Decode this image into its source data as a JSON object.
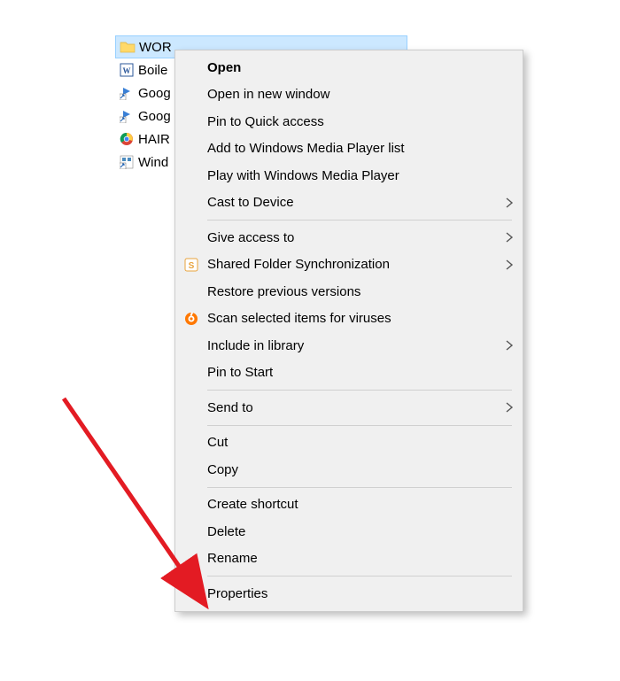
{
  "explorer": {
    "items": [
      {
        "label": "WOR",
        "icon": "folder-icon",
        "selected": true
      },
      {
        "label": "Boile",
        "icon": "word-doc-icon",
        "selected": false
      },
      {
        "label": "Goog",
        "icon": "shortcut-icon",
        "selected": false
      },
      {
        "label": "Goog",
        "icon": "shortcut-icon",
        "selected": false
      },
      {
        "label": "HAIR",
        "icon": "chrome-icon",
        "selected": false
      },
      {
        "label": "Wind",
        "icon": "app-shortcut-icon",
        "selected": false
      }
    ]
  },
  "context_menu": {
    "items": [
      {
        "label": "Open",
        "bold": true
      },
      {
        "label": "Open in new window"
      },
      {
        "label": "Pin to Quick access"
      },
      {
        "label": "Add to Windows Media Player list"
      },
      {
        "label": "Play with Windows Media Player"
      },
      {
        "label": "Cast to Device",
        "submenu": true
      },
      {
        "separator": true
      },
      {
        "label": "Give access to",
        "submenu": true
      },
      {
        "label": "Shared Folder Synchronization",
        "icon": "sync-icon",
        "submenu": true
      },
      {
        "label": "Restore previous versions"
      },
      {
        "label": "Scan selected items for viruses",
        "icon": "avast-icon"
      },
      {
        "label": "Include in library",
        "submenu": true
      },
      {
        "label": "Pin to Start"
      },
      {
        "separator": true
      },
      {
        "label": "Send to",
        "submenu": true
      },
      {
        "separator": true
      },
      {
        "label": "Cut"
      },
      {
        "label": "Copy"
      },
      {
        "separator": true
      },
      {
        "label": "Create shortcut"
      },
      {
        "label": "Delete"
      },
      {
        "label": "Rename"
      },
      {
        "separator": true
      },
      {
        "label": "Properties"
      }
    ]
  },
  "annotation": {
    "arrow_color": "#e31b23",
    "arrow_target": "Properties"
  }
}
